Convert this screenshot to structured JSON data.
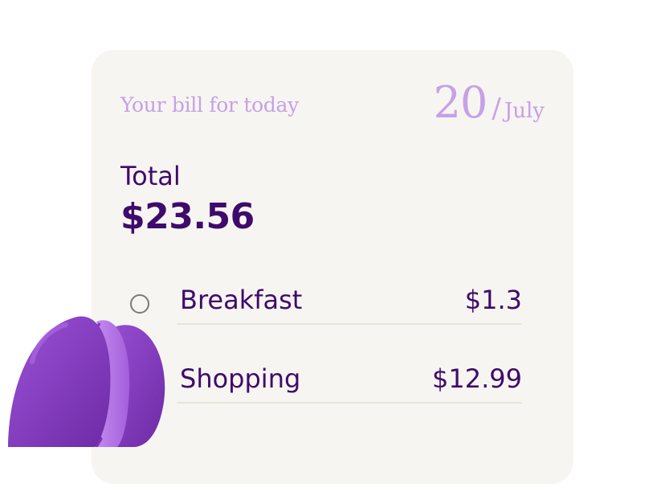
{
  "header": {
    "label": "Your bill for today",
    "date_day": "20",
    "date_separator": "/",
    "date_month": "July"
  },
  "total": {
    "label": "Total",
    "value": "$23.56"
  },
  "items": [
    {
      "label": "Breakfast",
      "value": "$1.3"
    },
    {
      "label": "Shopping",
      "value": "$12.99"
    }
  ],
  "colors": {
    "card_bg": "#f7f5f1",
    "accent_light": "#c6a1e6",
    "text_dark": "#3f0b6b",
    "divider": "#e7e5d6",
    "macaron": "#8e44c4"
  },
  "icons": {
    "radio": "radio-empty-icon",
    "decoration": "macaron-icon"
  }
}
